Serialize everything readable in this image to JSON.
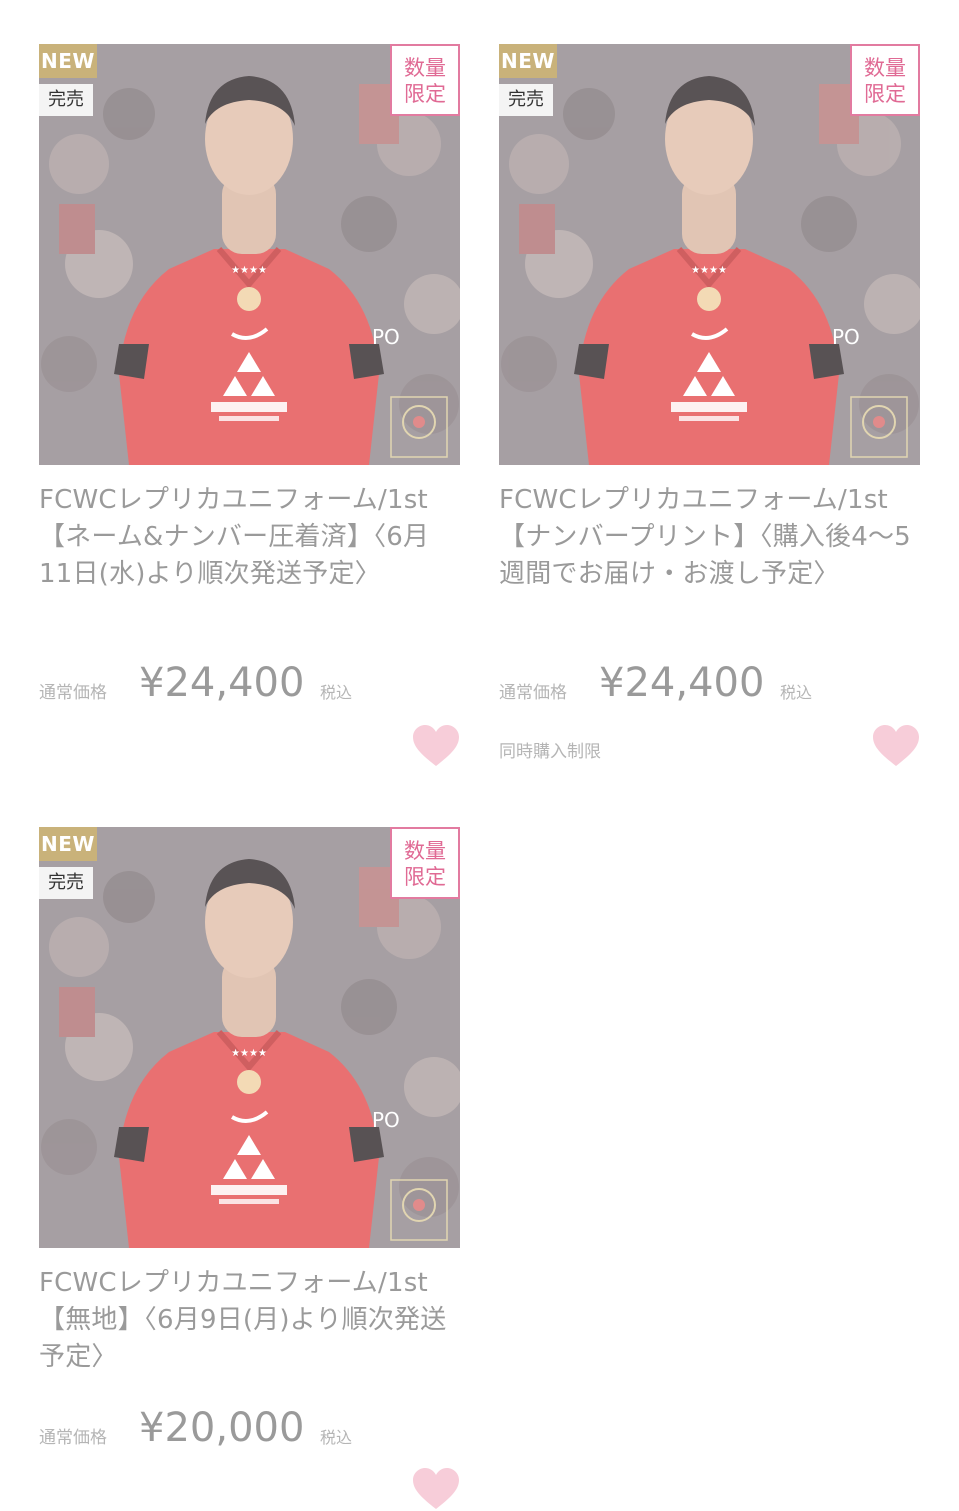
{
  "products": [
    {
      "badge_new": "NEW",
      "badge_sold": "完売",
      "badge_limited_1": "数量",
      "badge_limited_2": "限定",
      "title": "FCWCレプリカユニフォーム/1st【ネーム&ナンバー圧着済】〈6月11日(水)より順次発送予定〉",
      "price_label": "通常価格",
      "price": "¥24,400",
      "tax": "税込",
      "note": ""
    },
    {
      "badge_new": "NEW",
      "badge_sold": "完売",
      "badge_limited_1": "数量",
      "badge_limited_2": "限定",
      "title": "FCWCレプリカユニフォーム/1st 【ナンバープリント】〈購入後4〜5週間でお届け・お渡し予定〉",
      "price_label": "通常価格",
      "price": "¥24,400",
      "tax": "税込",
      "note": "同時購入制限"
    },
    {
      "badge_new": "NEW",
      "badge_sold": "完売",
      "badge_limited_1": "数量",
      "badge_limited_2": "限定",
      "title": "FCWCレプリカユニフォーム/1st 【無地】〈6月9日(月)より順次発送予定〉",
      "price_label": "通常価格",
      "price": "¥20,000",
      "tax": "税込",
      "note": ""
    }
  ],
  "icons": {
    "favorite": "heart-icon"
  },
  "colors": {
    "badge_new_bg": "#c9b27a",
    "badge_limited": "#e06a94",
    "heart": "#f7cdd9",
    "shirt": "#e3484a"
  }
}
